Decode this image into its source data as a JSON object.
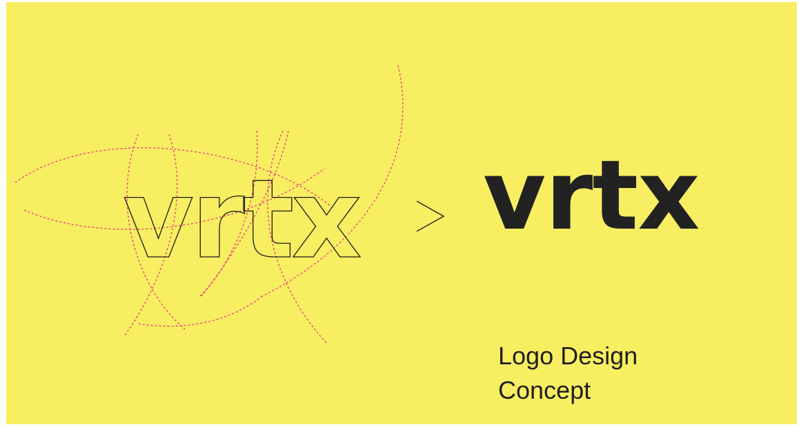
{
  "colors": {
    "background": "#f8ee62",
    "page_border": "#ffffff",
    "guides": "#e8287a",
    "logo_ink": "#222222"
  },
  "sketch_logo": {
    "text": "vrtx",
    "style": "outline",
    "icon": "construction-circles"
  },
  "arrow": {
    "icon": "chevron-right-icon",
    "glyph": ">"
  },
  "final_logo": {
    "text": "vrtx"
  },
  "caption": {
    "line1": "Logo Design",
    "line2": "Concept"
  }
}
